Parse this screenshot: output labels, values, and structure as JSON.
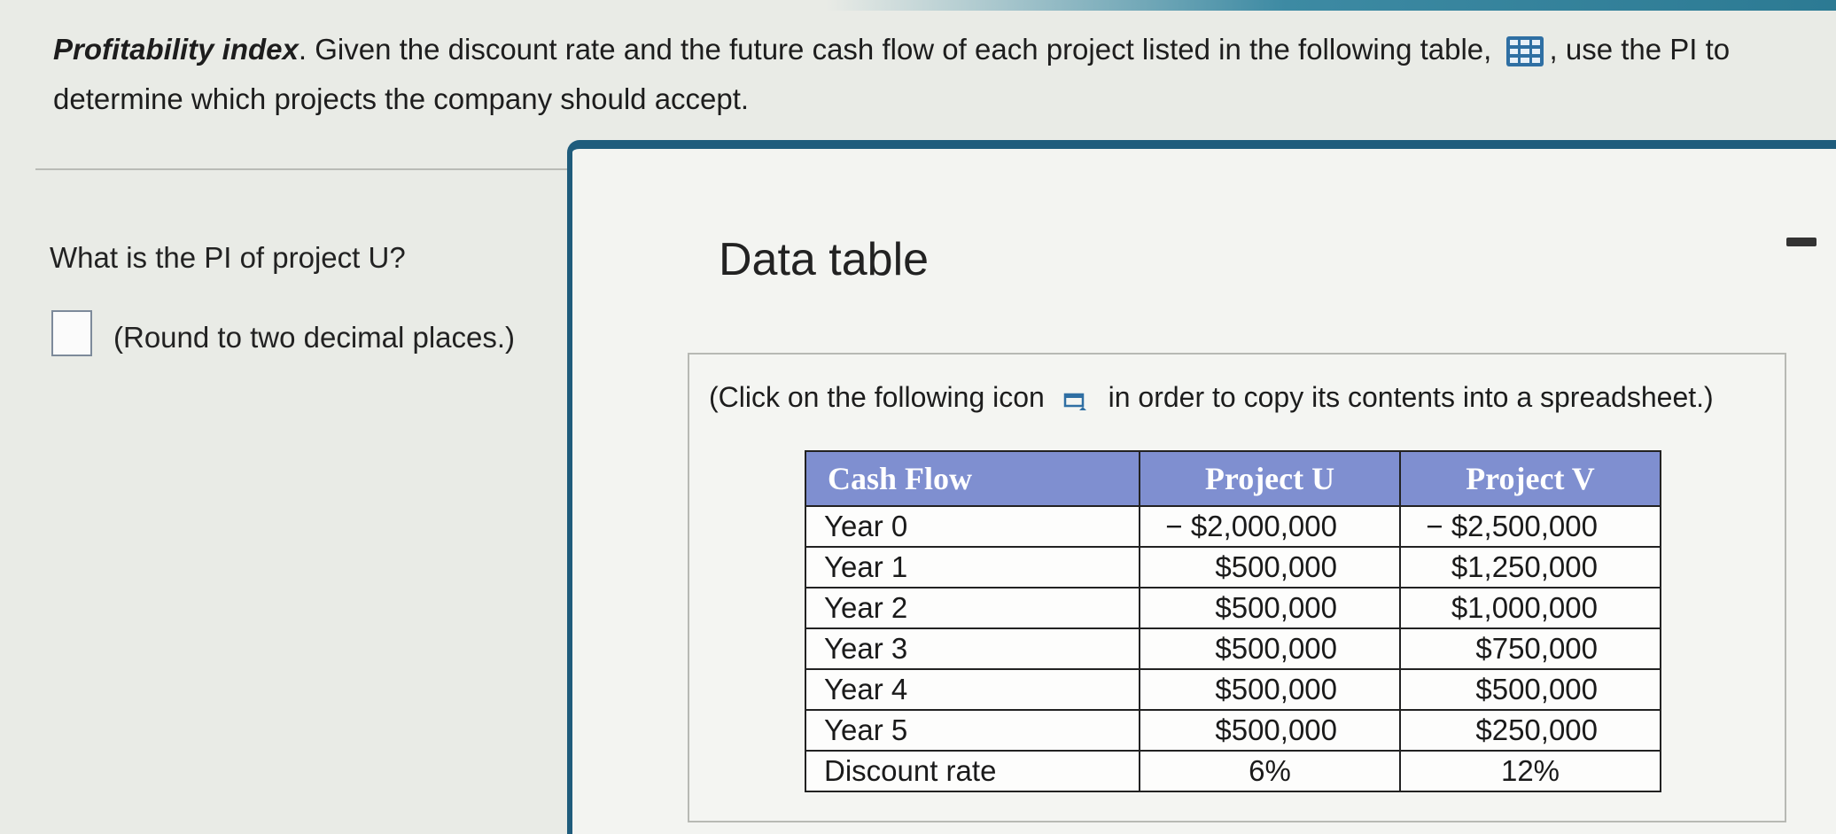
{
  "prompt": {
    "term": "Profitability index",
    "text_part1": ". Given the discount rate and the future cash flow of each project listed in the following table,",
    "text_part2": ", use the PI to determine which projects the company should accept."
  },
  "question": {
    "text": "What is the PI of project U?",
    "round_note": "(Round to two decimal places.)",
    "answer_value": ""
  },
  "modal": {
    "title": "Data table",
    "instruction_part1": "(Click on the following icon",
    "instruction_part2": "in order to copy its contents into a spreadsheet.)"
  },
  "table": {
    "headers": [
      "Cash Flow",
      "Project U",
      "Project V"
    ],
    "rows": [
      [
        "Year 0",
        "− $2,000,000",
        "− $2,500,000"
      ],
      [
        "Year 1",
        "$500,000",
        "$1,250,000"
      ],
      [
        "Year 2",
        "$500,000",
        "$1,000,000"
      ],
      [
        "Year 3",
        "$500,000",
        "$750,000"
      ],
      [
        "Year 4",
        "$500,000",
        "$500,000"
      ],
      [
        "Year 5",
        "$500,000",
        "$250,000"
      ],
      [
        "Discount rate",
        "6%",
        "12%"
      ]
    ]
  },
  "icons": {
    "data_table": "grid-icon",
    "copy": "copy-icon",
    "minimize": "minimize-icon"
  },
  "colors": {
    "header_bg": "#7f8fd0",
    "modal_border": "#1f5c7c",
    "grid_icon": "#2f6fa3"
  }
}
